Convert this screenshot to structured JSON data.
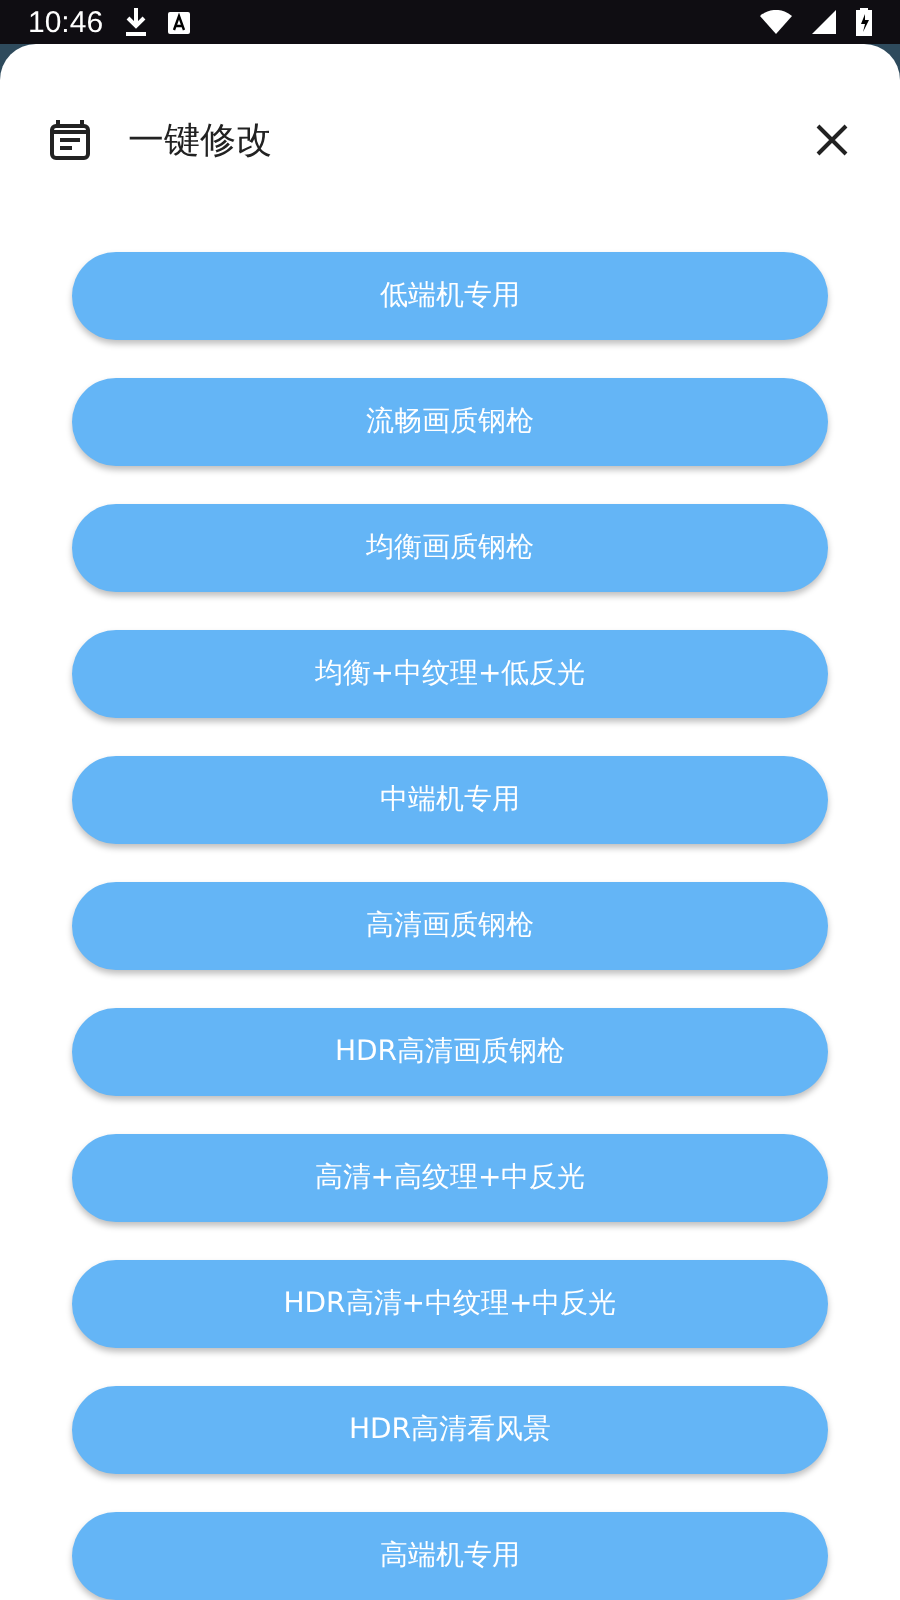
{
  "status_bar": {
    "time": "10:46"
  },
  "dialog": {
    "title": "一键修改"
  },
  "presets": [
    {
      "label": "低端机专用"
    },
    {
      "label": "流畅画质钢枪"
    },
    {
      "label": "均衡画质钢枪"
    },
    {
      "label": "均衡+中纹理+低反光"
    },
    {
      "label": "中端机专用"
    },
    {
      "label": "高清画质钢枪"
    },
    {
      "label": "HDR高清画质钢枪"
    },
    {
      "label": "高清+高纹理+中反光"
    },
    {
      "label": "HDR高清+中纹理+中反光"
    },
    {
      "label": "HDR高清看风景"
    },
    {
      "label": "高端机专用"
    }
  ]
}
